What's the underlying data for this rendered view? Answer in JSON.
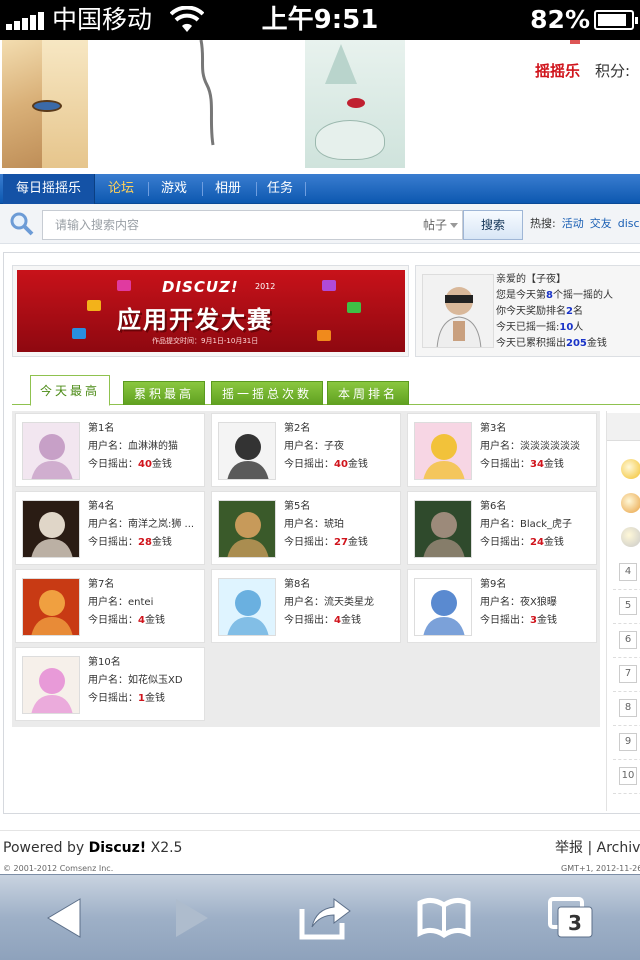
{
  "status_bar": {
    "carrier": "中国移动",
    "time": "上午9:51",
    "battery": "82%"
  },
  "banner": {
    "shake_link": "摇摇乐",
    "score_label": "积分: "
  },
  "nav": {
    "tabs": [
      "每日摇摇乐",
      "论坛",
      "游戏",
      "相册",
      "任务"
    ],
    "active_index": 0
  },
  "search": {
    "placeholder": "请输入搜索内容",
    "type": "帖子",
    "button": "搜索",
    "hot_label": "热搜:",
    "hot_links": [
      "活动",
      "交友",
      "discu"
    ]
  },
  "ad": {
    "brand": "DISCUZ!",
    "year": "2012",
    "title": "应用开发大赛",
    "subtitle": "作品提交时间：9月1日-10月31日"
  },
  "user_panel": {
    "line1": "亲爱的【子夜】",
    "line2_pre": "您是今天第",
    "line2_num": "8",
    "line2_post": "个摇一摇的人",
    "line3_pre": "你今天奖励排名",
    "line3_num": "2",
    "line3_post": "名",
    "line4_pre": "今天已摇一摇:",
    "line4_num": "10",
    "line4_post": "人",
    "line5_pre": "今天已累积摇出",
    "line5_num": "205",
    "line5_post": "金钱"
  },
  "ranking_tabs": [
    "今天最高",
    "累积最高",
    "摇一摇总次数",
    "本周排名"
  ],
  "ranking": [
    {
      "rank": "第1名",
      "user_label": "用户名：",
      "user": "血淋淋的猫",
      "today_label": "今日摇出：",
      "amount": "40",
      "unit": "金钱"
    },
    {
      "rank": "第2名",
      "user_label": "用户名：",
      "user": "子夜",
      "today_label": "今日摇出：",
      "amount": "40",
      "unit": "金钱"
    },
    {
      "rank": "第3名",
      "user_label": "用户名：",
      "user": "淡淡淡淡淡淡",
      "today_label": "今日摇出：",
      "amount": "34",
      "unit": "金钱"
    },
    {
      "rank": "第4名",
      "user_label": "用户名：",
      "user": "南洋之岚:狮 ...",
      "today_label": "今日摇出：",
      "amount": "28",
      "unit": "金钱"
    },
    {
      "rank": "第5名",
      "user_label": "用户名：",
      "user": "琥珀",
      "today_label": "今日摇出：",
      "amount": "27",
      "unit": "金钱"
    },
    {
      "rank": "第6名",
      "user_label": "用户名：",
      "user": "Black_虎子",
      "today_label": "今日摇出：",
      "amount": "24",
      "unit": "金钱"
    },
    {
      "rank": "第7名",
      "user_label": "用户名：",
      "user": "entei",
      "today_label": "今日摇出：",
      "amount": "4",
      "unit": "金钱"
    },
    {
      "rank": "第8名",
      "user_label": "用户名：",
      "user": "流天类星龙",
      "today_label": "今日摇出：",
      "amount": "4",
      "unit": "金钱"
    },
    {
      "rank": "第9名",
      "user_label": "用户名：",
      "user": "夜X狼曝",
      "today_label": "今日摇出：",
      "amount": "3",
      "unit": "金钱"
    },
    {
      "rank": "第10名",
      "user_label": "用户名：",
      "user": "如花似玉XD",
      "today_label": "今日摇出：",
      "amount": "1",
      "unit": "金钱"
    }
  ],
  "right_ranks": [
    "4",
    "5",
    "6",
    "7",
    "8",
    "9",
    "10"
  ],
  "footer": {
    "powered_pre": "Powered by ",
    "powered_brand": "Discuz!",
    "powered_ver": " X2.5",
    "report": "举报 | Archiv",
    "copyright": "© 2001-2012 Comsenz Inc.",
    "gmt": "GMT+1, 2012-11-26"
  },
  "colors": {
    "nav": "#1a5fb4",
    "accent_green": "#6fb02a",
    "amount_red": "#d0141c"
  }
}
